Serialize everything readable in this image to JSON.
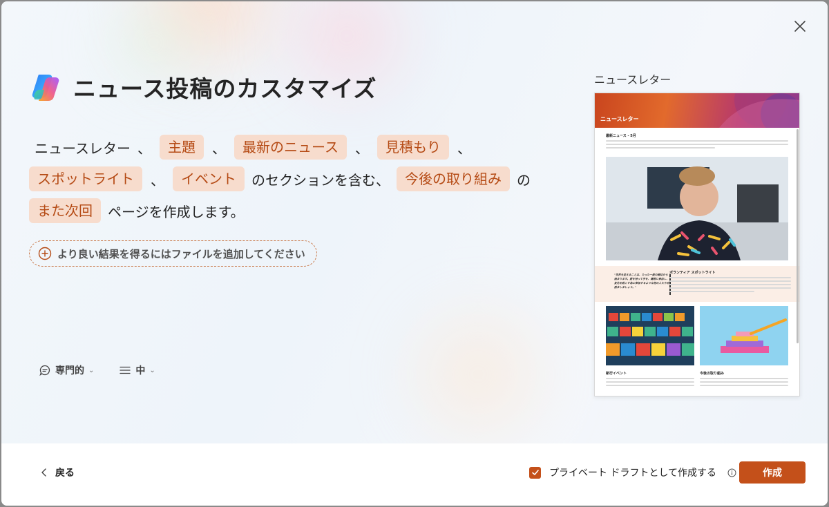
{
  "dialog": {
    "title": "ニュース投稿のカスタマイズ"
  },
  "prompt": {
    "line1": {
      "t1": "ニュースレター",
      "sep1": "、",
      "chip1": "主題",
      "sep2": "、",
      "chip2": "最新のニュース",
      "sep3": "、",
      "chip3": "見積もり",
      "sep4": "、"
    },
    "line2": {
      "chip1": "スポットライト",
      "sep1": "、",
      "chip2": "イベント",
      "t1": "のセクションを含む、",
      "chip3": "今後の取り組み",
      "t2": "の"
    },
    "line3": {
      "chip1": "また次回",
      "t1": "ページを作成します。"
    }
  },
  "add_file": {
    "label": "より良い結果を得るにはファイルを追加してください"
  },
  "options": {
    "tone": {
      "label": "専門的"
    },
    "length": {
      "label": "中"
    }
  },
  "preview": {
    "label": "ニュースレター",
    "banner_title": "ニュースレター",
    "section1": "最新ニュース - 5月",
    "section2": "ボランティア スポットライト",
    "quote": "\"世界を変えることは、たった一度の親切から始まります。愛を持って手を、講習に参加し、変化を起こす為に参加するような他の人たちを励ましましょう。\"",
    "section3": "新行イベント",
    "section4": "今後の取り組み"
  },
  "footer": {
    "back_label": "戻る",
    "draft_label": "プライベート ドラフトとして作成する",
    "draft_checked": true,
    "create_label": "作成"
  },
  "colors": {
    "accent": "#c4501a",
    "chip_bg": "#f7dccd",
    "chip_text": "#b54a14"
  }
}
